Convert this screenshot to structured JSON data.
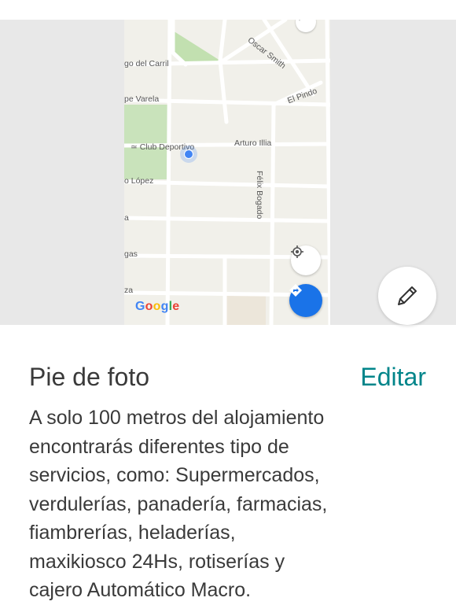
{
  "map": {
    "streets": {
      "oscar_smith": "Oscar Smith",
      "gomez_del_carril": "go del Carril",
      "el_pindo": "El Pindo",
      "varela": "pe Varela",
      "club": "Club Deportivo",
      "arturo_illia": "Arturo Illia",
      "lopez": "o López",
      "felix_bogado": "Félix Bogado",
      "frag_a": "a",
      "frag_gas": "gas",
      "frag_za": "za"
    },
    "logo": {
      "g1": "G",
      "o1": "o",
      "o2": "o",
      "g2": "g",
      "l": "l",
      "e": "e"
    },
    "colors": {
      "water_park": "#b7dca6",
      "road": "#ffffff",
      "location_dot": "#4285f4",
      "directions_button": "#1a73e8"
    },
    "icons": {
      "location": "my-location-icon",
      "directions": "directions-icon",
      "compass": "compass-icon"
    }
  },
  "edit_fab": {
    "icon": "pencil-icon"
  },
  "caption": {
    "title": "Pie de foto",
    "edit_label": "Editar",
    "text": "A solo 100 metros del alojamiento\nencontrarás diferentes tipo de\nservicios, como: Supermercados,\nverdulerías, panadería, farmacias,\nfiambrerías, heladerías,\nmaxikiosco 24Hs, rotiserías y\ncajero Automático Macro."
  },
  "colors": {
    "accent": "#00858a",
    "text": "#3a3a3a"
  }
}
